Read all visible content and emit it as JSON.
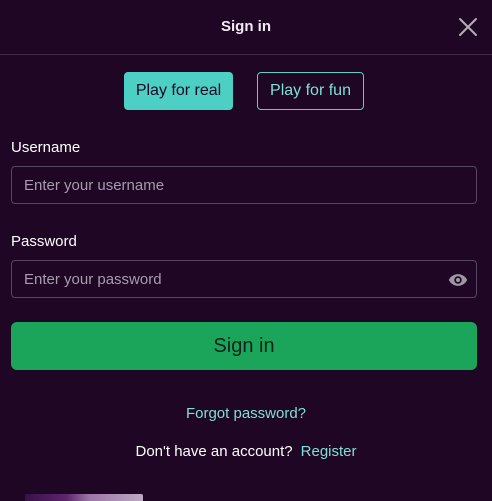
{
  "modal": {
    "title": "Sign in",
    "close_icon": "close-icon"
  },
  "mode_switch": {
    "real_label": "Play for real",
    "fun_label": "Play for fun",
    "selected": "Play for real"
  },
  "form": {
    "username": {
      "label": "Username",
      "placeholder": "Enter your username",
      "value": ""
    },
    "password": {
      "label": "Password",
      "placeholder": "Enter your password",
      "value": "",
      "toggle_icon": "eye-icon"
    },
    "submit_label": "Sign in"
  },
  "links": {
    "forgot_password": "Forgot password?",
    "register_prompt": "Don't have an account?",
    "register": "Register"
  },
  "colors": {
    "background": "#1e0624",
    "accent": "#4dd0c4",
    "link": "#7fe0d7",
    "submit": "#1aa55a"
  }
}
